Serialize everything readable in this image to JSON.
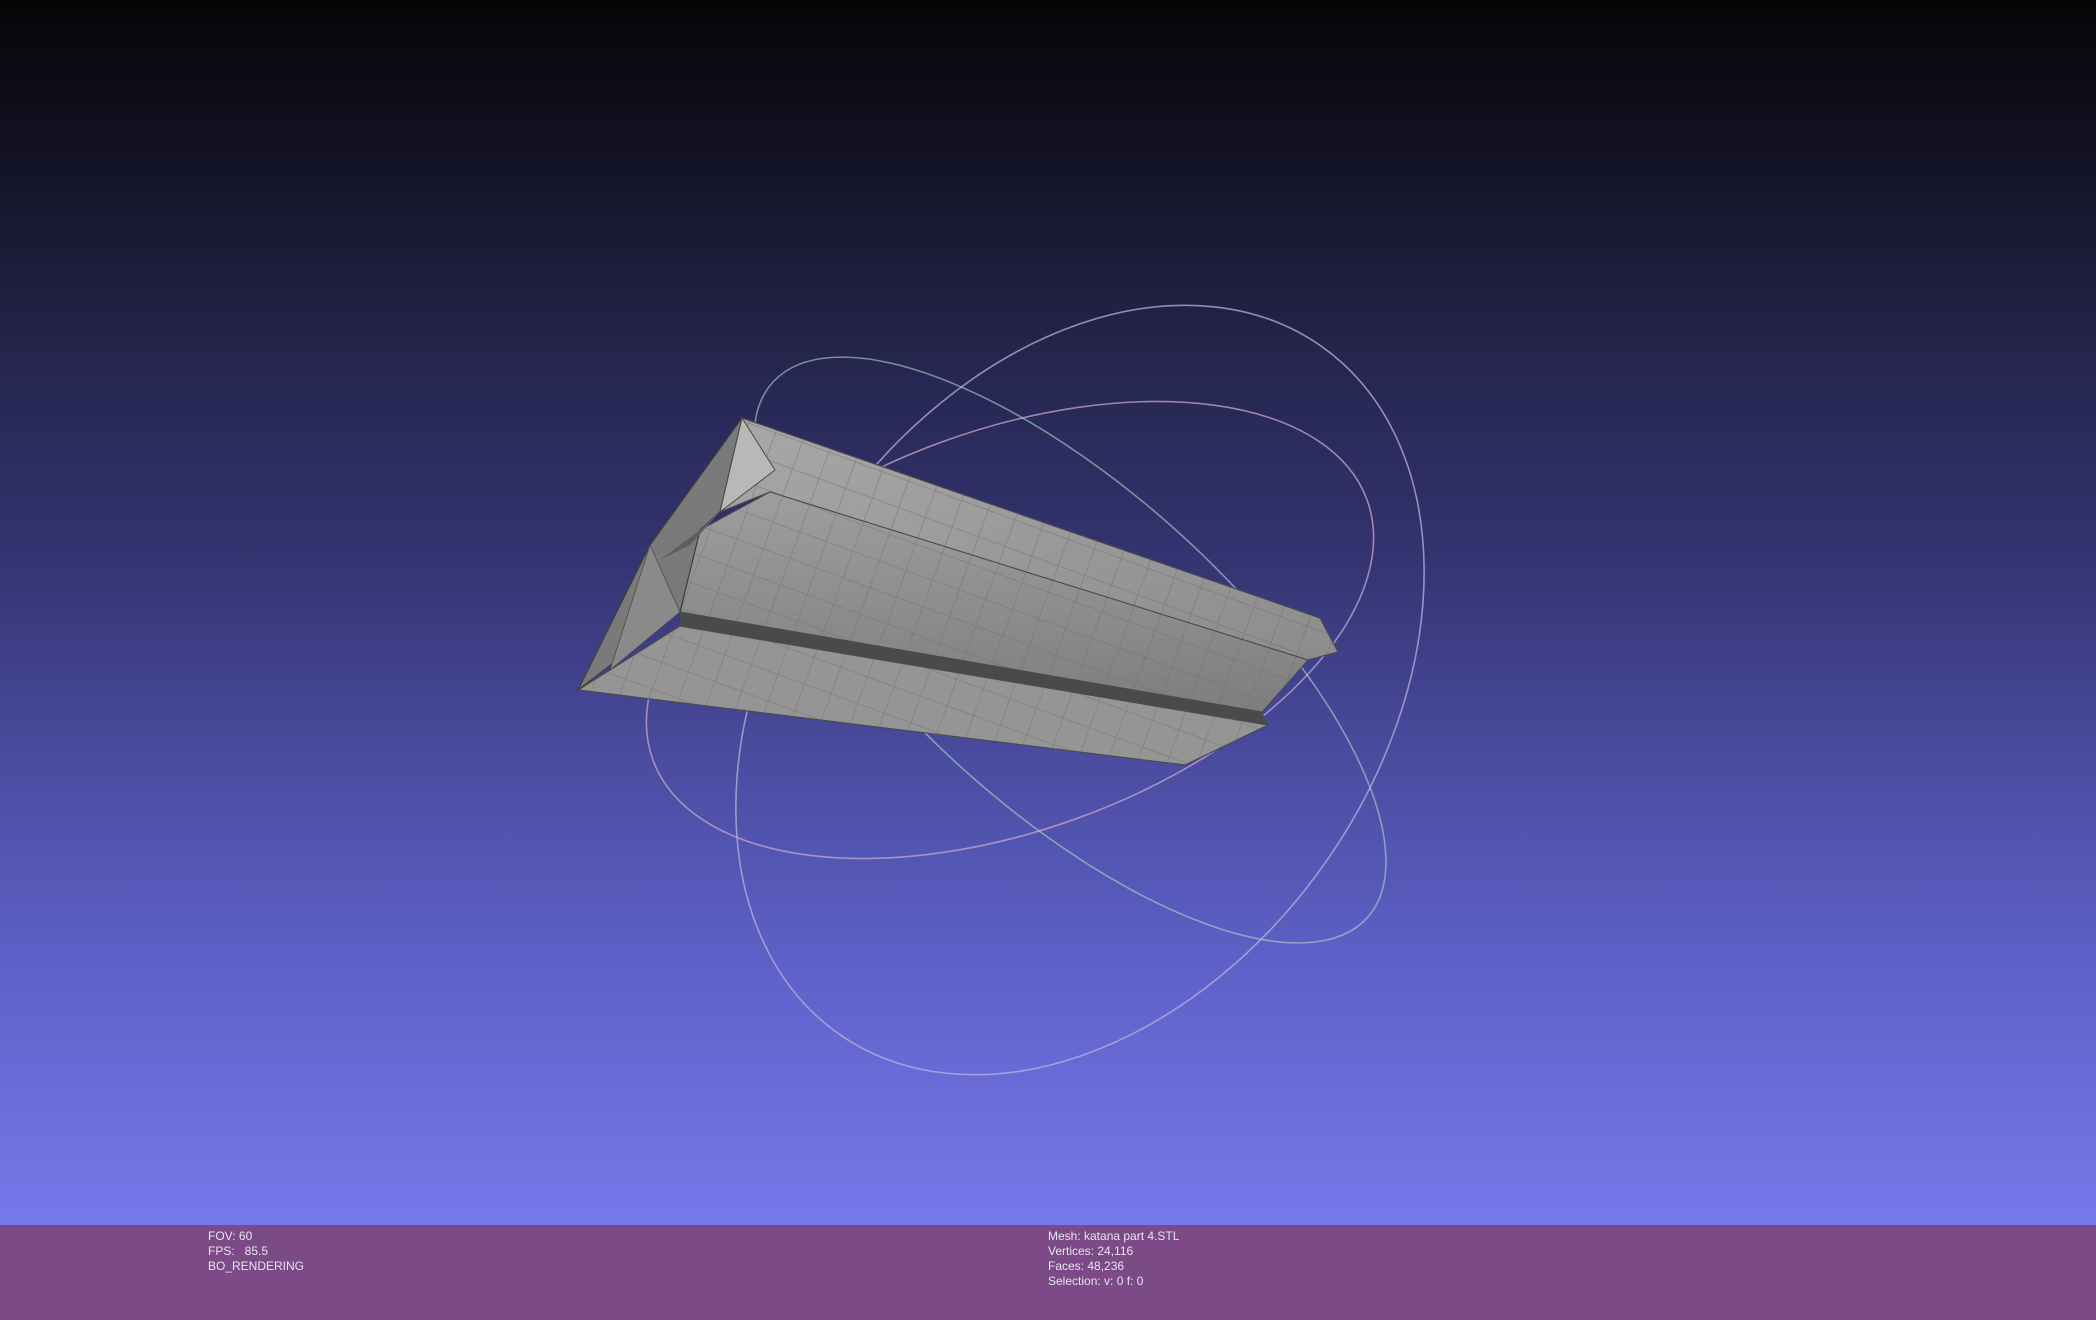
{
  "viewport": {
    "background_top": "#050507",
    "background_bottom": "#7679ea",
    "mesh_color": "#9a9a9a",
    "trackball_colors": [
      "#b48fb8",
      "#8fa0d0",
      "#a0e0c0"
    ]
  },
  "info_bar": {
    "background": "#7d4a88",
    "left": {
      "fov": "FOV: 60",
      "fps": "FPS:   85.5",
      "mode": "BO_RENDERING"
    },
    "right": {
      "mesh": "Mesh: katana part 4.STL",
      "vertices": "Vertices: 24,116",
      "faces": "Faces: 48,236",
      "selection": "Selection: v: 0 f: 0"
    }
  }
}
